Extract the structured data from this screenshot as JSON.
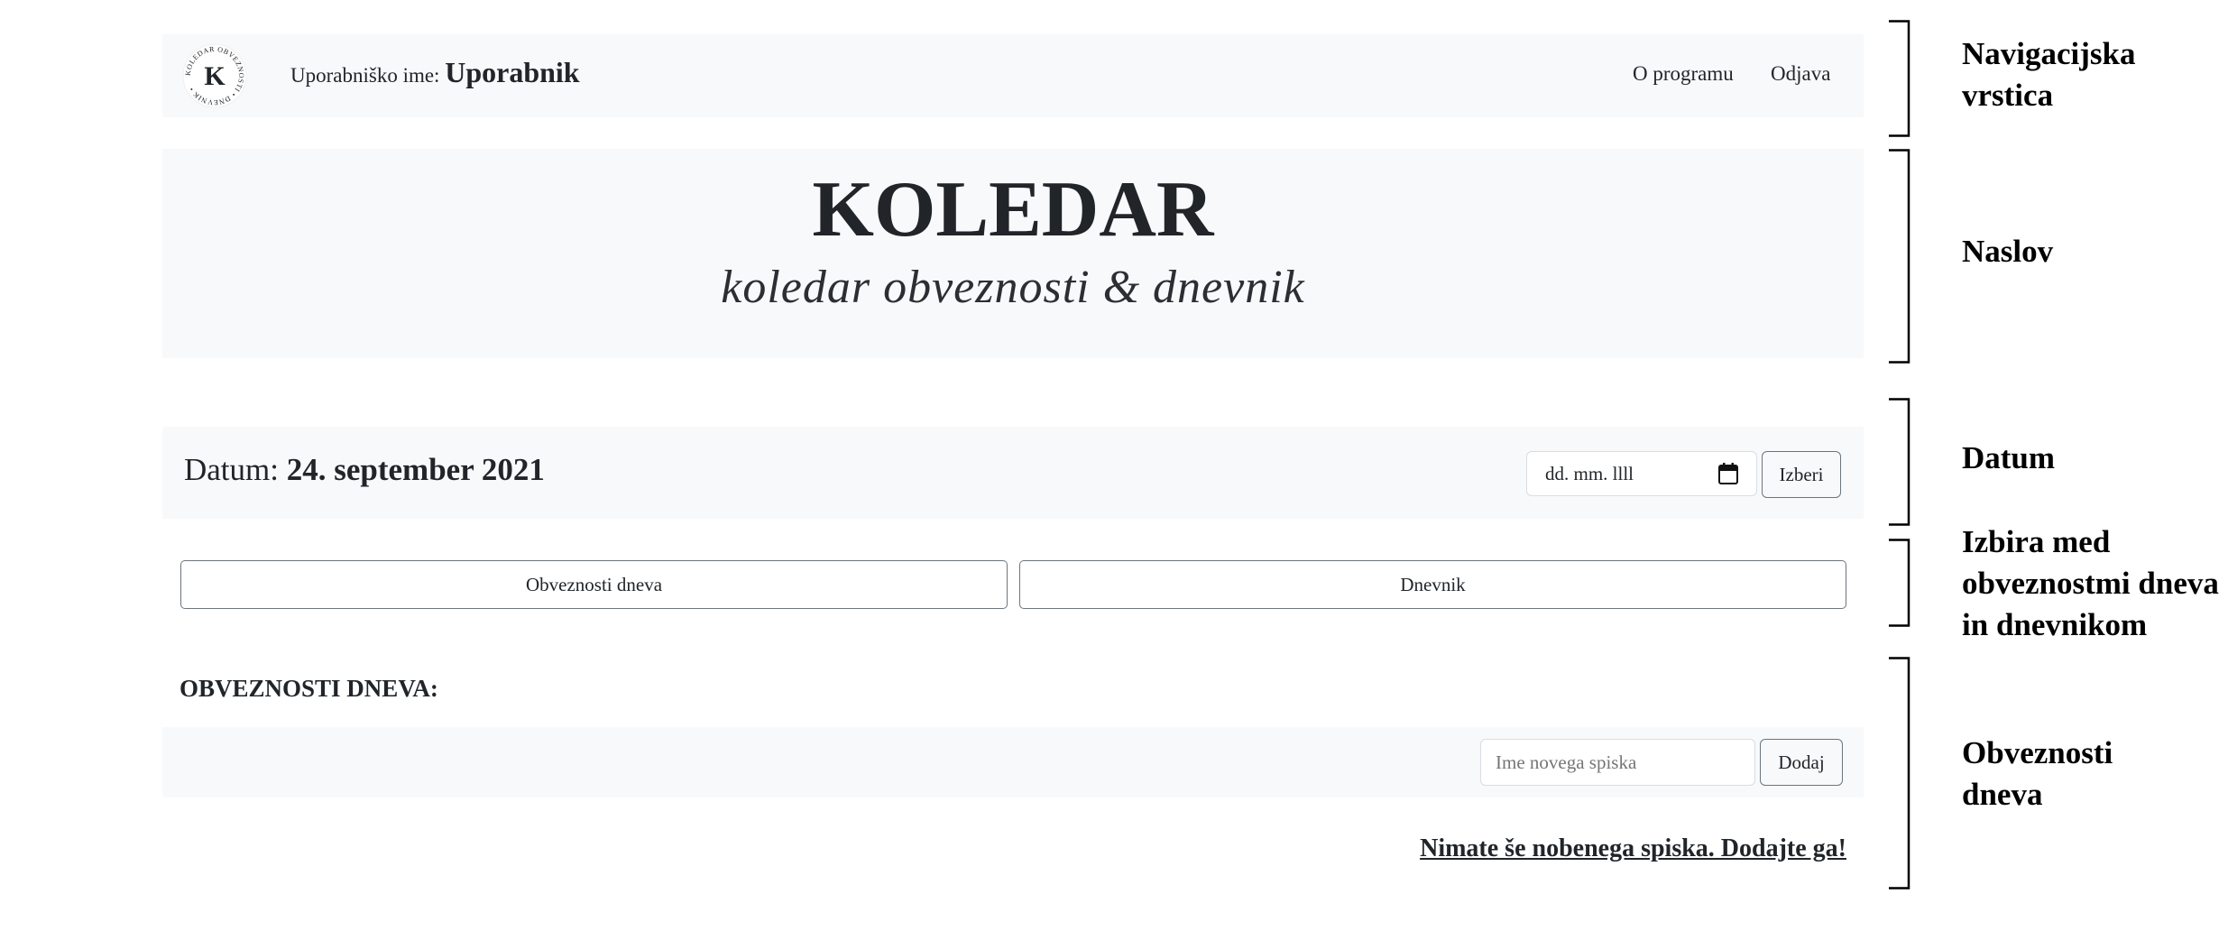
{
  "navbar": {
    "logo": {
      "initial": "K",
      "ring_text": "KOLEDAR OBVEZNOSTI • DNEVNIK •"
    },
    "username_label": "Uporabniško ime:",
    "username_value": "Uporabnik",
    "links": {
      "about": "O programu",
      "logout": "Odjava"
    }
  },
  "header": {
    "title": "KOLEDAR",
    "subtitle": "koledar obveznosti & dnevnik"
  },
  "datebar": {
    "label": "Datum:",
    "value": "24. september 2021",
    "date_input_placeholder": "dd. mm. llll",
    "choose_button": "Izberi"
  },
  "toggle": {
    "obligations": "Obveznosti dneva",
    "diary": "Dnevnik"
  },
  "obligations": {
    "heading": "OBVEZNOSTI DNEVA:",
    "new_list_placeholder": "Ime novega spiska",
    "add_button": "Dodaj",
    "empty_message": "Nimate še nobenega spiska. Dodajte ga!"
  },
  "annotations": {
    "navbar": [
      "Navigacijska",
      "vrstica"
    ],
    "header": [
      "Naslov"
    ],
    "date": [
      "Datum"
    ],
    "toggle": [
      "Izbira med",
      "obveznostmi dneva",
      "in dnevnikom"
    ],
    "obligations": [
      "Obveznosti",
      "dneva"
    ]
  },
  "colors": {
    "panel_bg": "#f8f9fa",
    "text": "#212529",
    "border": "#6c757d"
  }
}
